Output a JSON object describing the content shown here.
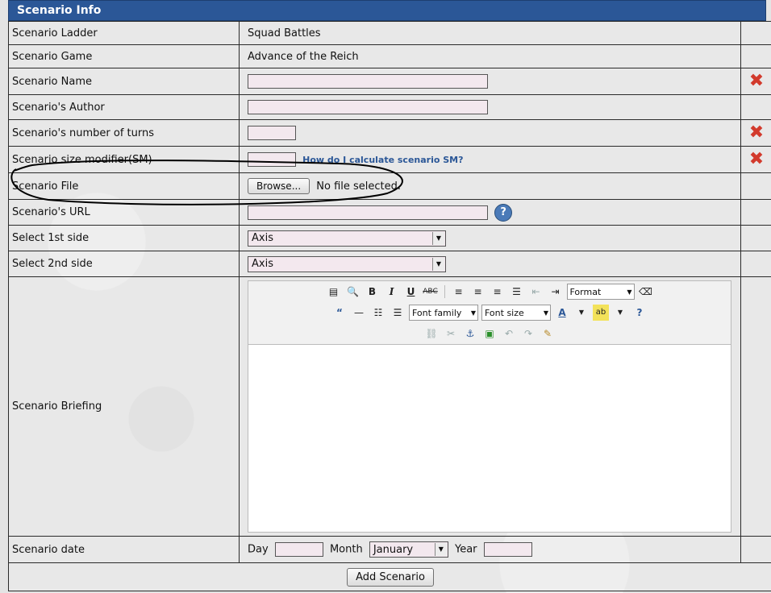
{
  "header": {
    "title": "Scenario Info"
  },
  "rows": {
    "ladder": {
      "label": "Scenario Ladder",
      "value": "Squad Battles"
    },
    "game": {
      "label": "Scenario Game",
      "value": "Advance of the Reich"
    },
    "name": {
      "label": "Scenario Name"
    },
    "author": {
      "label": "Scenario's Author"
    },
    "turns": {
      "label": "Scenario's number of turns"
    },
    "sm": {
      "label": "Scenario size modifier(SM)",
      "help": "How do I calculate scenario SM?"
    },
    "file": {
      "label": "Scenario File",
      "browse": "Browse...",
      "status": "No file selected."
    },
    "url": {
      "label": "Scenario's URL"
    },
    "side1": {
      "label": "Select 1st side",
      "selected": "Axis"
    },
    "side2": {
      "label": "Select 2nd side",
      "selected": "Axis"
    },
    "briefing": {
      "label": "Scenario Briefing"
    },
    "date": {
      "label": "Scenario date",
      "day": "Day",
      "month": "Month",
      "month_selected": "January",
      "year": "Year"
    }
  },
  "editor": {
    "format": "Format",
    "font_family": "Font family",
    "font_size": "Font size"
  },
  "submit": {
    "label": "Add Scenario"
  },
  "colors": {
    "header": "#2b5797",
    "link": "#2b5797",
    "delete": "#d23a2c",
    "input_bg": "#f3e8ee"
  }
}
